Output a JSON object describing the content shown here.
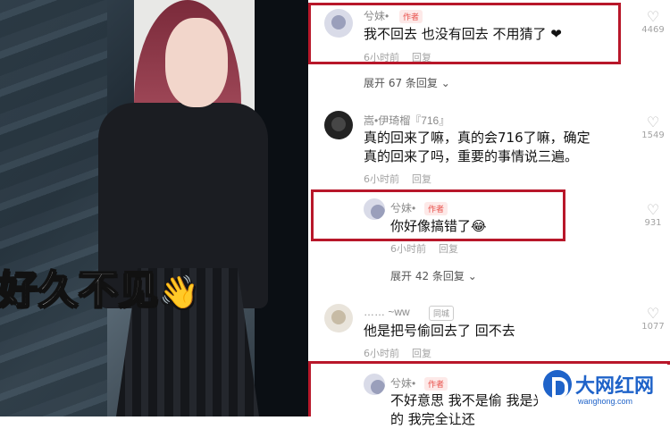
{
  "photo": {
    "caption": "好久不见",
    "caption_emoji": "👋"
  },
  "comments": [
    {
      "user": "兮妹•",
      "badge": "作者",
      "text": "我不回去 也没有回去 不用猜了 ❤",
      "time": "6小时前",
      "reply": "回复",
      "likes": "4469"
    },
    {
      "expand": "展开 67 条回复"
    },
    {
      "user": "嵩•伊琦榴『716』",
      "text_lines": [
        "真的回来了嘛，真的会716了嘛，确定",
        "真的回来了吗，重要的事情说三遍。"
      ],
      "time": "6小时前",
      "reply": "回复",
      "likes": "1549"
    },
    {
      "user": "兮妹•",
      "badge": "作者",
      "text": "你好像搞错了😂",
      "time": "6小时前",
      "reply": "回复",
      "likes": "931"
    },
    {
      "expand": "展开 42 条回复"
    },
    {
      "user": "…… ~ww",
      "badge": "同城",
      "text": "他是把号偷回去了  回不去",
      "time": "6小时前",
      "reply": "回复",
      "likes": "1077"
    },
    {
      "user": "兮妹•",
      "badge": "作者",
      "text": "不好意思 我不是偷 我是光明正大亲爱的 我完全让还"
    }
  ],
  "watermark": {
    "name": "大网红网",
    "url": "wanghong.com"
  },
  "colors": {
    "highlight": "#b8172a",
    "author_badge": "#e8504a",
    "brand": "#1f63c9"
  }
}
